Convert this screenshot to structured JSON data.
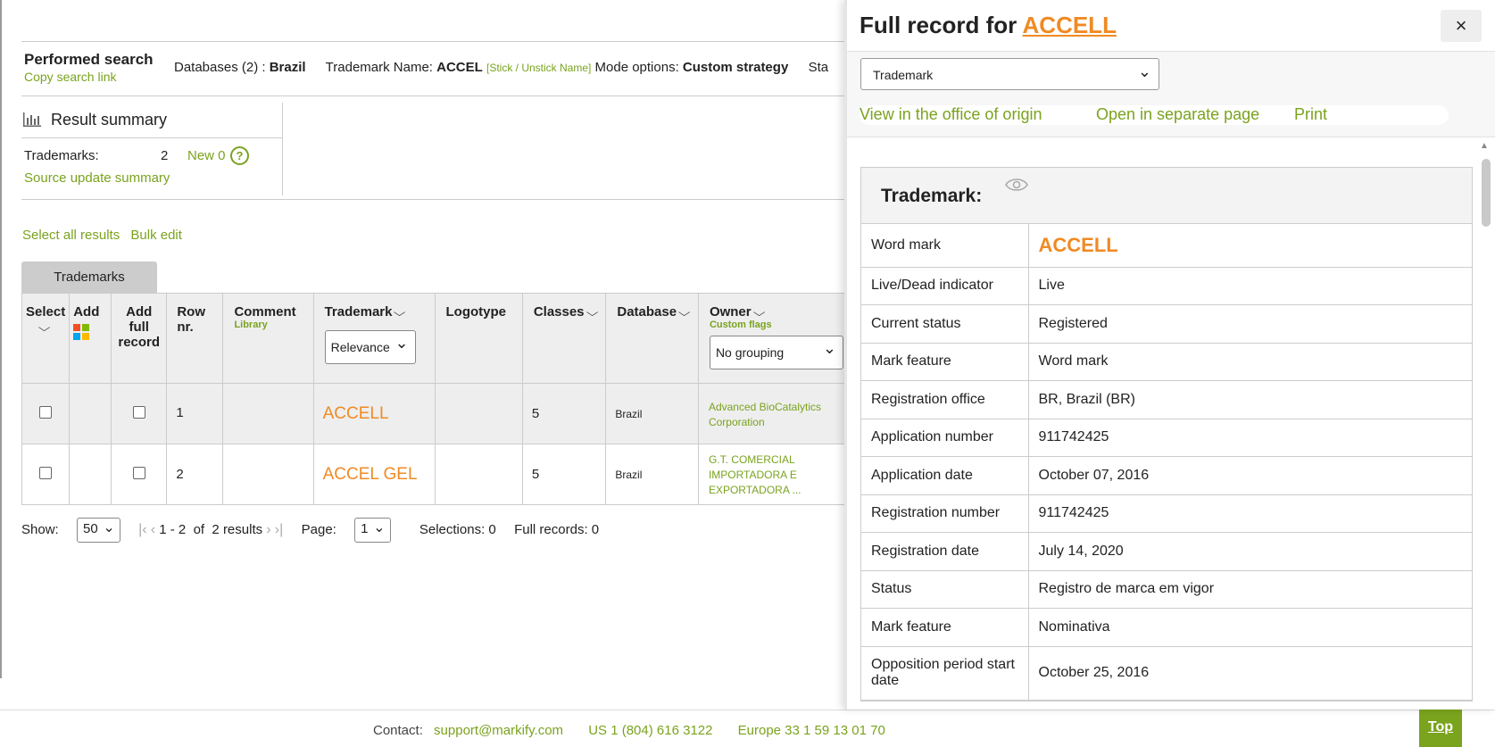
{
  "search": {
    "title": "Performed search",
    "copy_link": "Copy search link",
    "databases_label": "Databases (2) :",
    "databases_value": "Brazil",
    "tm_name_label": "Trademark Name:",
    "tm_name_value": "ACCEL",
    "stick": "[Stick / Unstick Name]",
    "mode_label": "Mode options:",
    "mode_value": "Custom strategy",
    "truncated": "Sta"
  },
  "summary": {
    "title": "Result summary",
    "trademarks_label": "Trademarks:",
    "trademarks_count": "2",
    "new_label": "New 0",
    "help": "?",
    "source_update": "Source update summary"
  },
  "actions": {
    "select_all": "Select all results",
    "bulk_edit": "Bulk edit"
  },
  "tab": "Trademarks",
  "table": {
    "headers": {
      "select": "Select",
      "add": "Add",
      "add_full_1": "Add full",
      "add_full_2": "record",
      "row_1": "Row",
      "row_2": "nr.",
      "comment": "Comment",
      "comment_sub": "Library",
      "trademark": "Trademark",
      "sort_select": "Relevance",
      "logotype": "Logotype",
      "classes": "Classes",
      "database": "Database",
      "owner": "Owner",
      "owner_sub": "Custom flags",
      "grouping": "No grouping"
    },
    "rows": [
      {
        "nr": "1",
        "trademark": "ACCELL",
        "classes": "5",
        "database": "Brazil",
        "owner": "Advanced BioCatalytics Corporation"
      },
      {
        "nr": "2",
        "trademark": "ACCEL GEL",
        "classes": "5",
        "database": "Brazil",
        "owner": "G.T. COMERCIAL IMPORTADORA E EXPORTADORA ..."
      }
    ]
  },
  "pager": {
    "show_label": "Show:",
    "show_value": "50",
    "range": "1 - 2  of  2 results",
    "page_label": "Page:",
    "page_value": "1",
    "selections": "Selections: 0",
    "full_records": "Full records: 0"
  },
  "footer": {
    "contact": "Contact:",
    "email": "support@markify.com",
    "us": "US 1 (804) 616 3122",
    "europe": "Europe 33 1 59 13 01 70",
    "top": "Top"
  },
  "panel": {
    "title_prefix": "Full record for",
    "title_mark": "ACCELL",
    "close": "×",
    "type_select": "Trademark",
    "link_origin": "View in the office of origin",
    "link_separate": "Open in separate page",
    "link_print": "Print",
    "section_title": "Trademark:",
    "fields": [
      {
        "key": "Word mark",
        "value": "ACCELL"
      },
      {
        "key": "Live/Dead indicator",
        "value": "Live"
      },
      {
        "key": "Current status",
        "value": "Registered"
      },
      {
        "key": "Mark feature",
        "value": "Word mark"
      },
      {
        "key": "Registration office",
        "value": "BR, Brazil (BR)"
      },
      {
        "key": "Application number",
        "value": "911742425"
      },
      {
        "key": "Application date",
        "value": "October 07, 2016"
      },
      {
        "key": "Registration number",
        "value": "911742425"
      },
      {
        "key": "Registration date",
        "value": "July 14, 2020"
      },
      {
        "key": "Status",
        "value": "Registro de marca em vigor"
      },
      {
        "key": "Mark feature",
        "value": "Nominativa"
      },
      {
        "key": "Opposition period start date",
        "value": "October 25, 2016"
      }
    ]
  },
  "colors": {
    "accent_green": "#7aa31e",
    "mark_orange": "#f08a24",
    "header_gray": "#eeeeee"
  }
}
